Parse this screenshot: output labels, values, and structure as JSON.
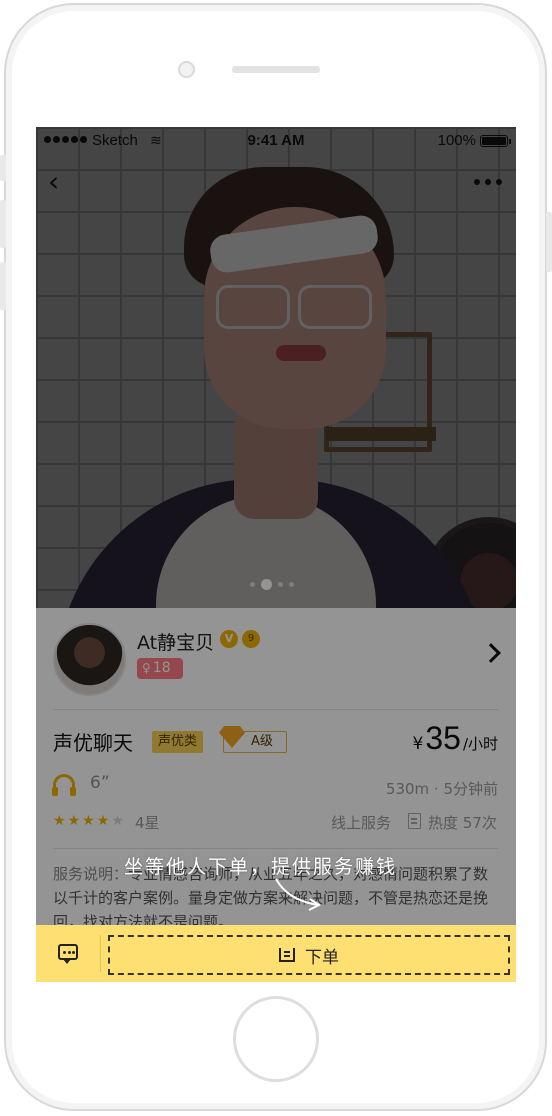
{
  "statusbar": {
    "carrier": "Sketch",
    "time": "9:41 AM",
    "battery": "100%"
  },
  "nav": {
    "back_icon": "chevron-left",
    "more_icon": "ellipsis"
  },
  "carousel": {
    "count": 4,
    "active_index": 1
  },
  "profile": {
    "name": "At静宝贝",
    "vip_badge": "V",
    "level_badge": "9",
    "gender_symbol": "♀",
    "age": "18"
  },
  "service": {
    "title": "声优聊天",
    "category": "声优类",
    "grade": "A级",
    "price_symbol": "¥",
    "price": "35",
    "price_unit": "/小时",
    "duration": "6”",
    "distance": "530m · 5分钟前",
    "rating_stars": 4,
    "rating_max": 5,
    "rating_label": "4星",
    "mode": "线上服务",
    "heat": "热度 57次"
  },
  "description": {
    "label": "服务说明：",
    "text": "专业情感咨询师，从业五年之久，对感情问题积累了数以千计的客户案例。量身定做方案来解决问题，不管是热恋还是挽回，找对方法就不是问题。"
  },
  "tutorial": {
    "hint": "坐等他人下单，提供服务赚钱"
  },
  "bottom_bar": {
    "order_label": "下单",
    "chat_icon": "chat-bubble",
    "order_icon": "order-list"
  },
  "colors": {
    "accent": "#fde071",
    "badge_gold": "#f0b400",
    "female_tag": "#ff7b84"
  }
}
